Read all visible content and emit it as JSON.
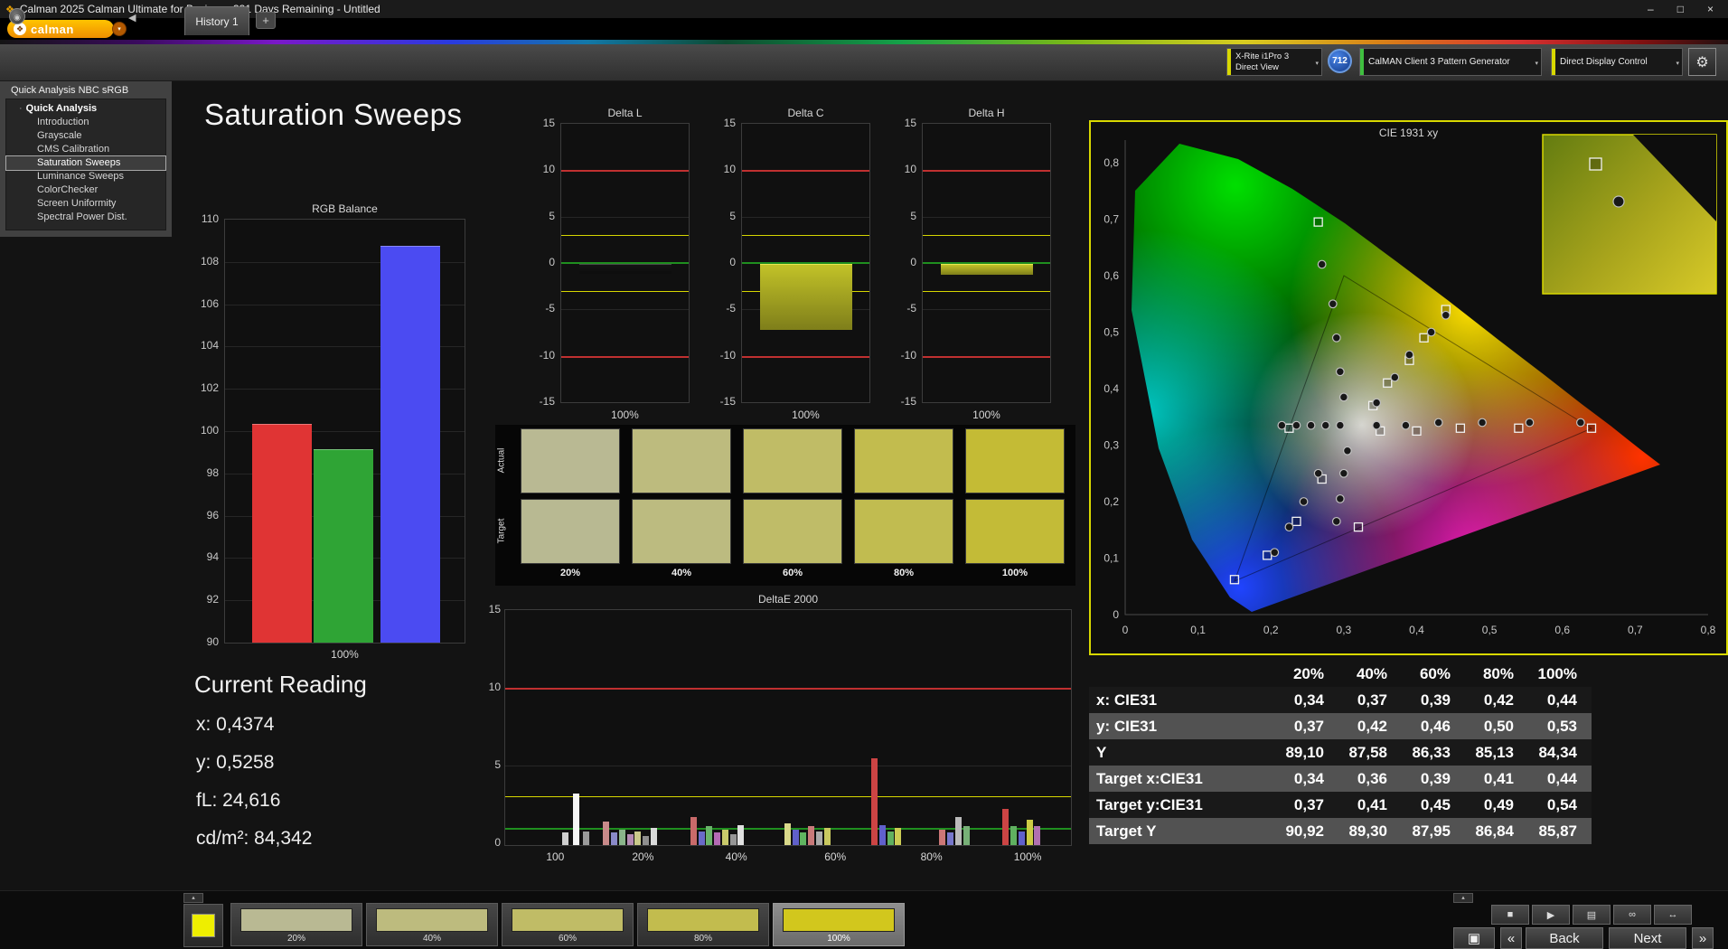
{
  "window": {
    "title": "Calman 2025 Calman Ultimate for Business 331 Days Remaining  - Untitled",
    "controls": {
      "minimize": "–",
      "maximize": "□",
      "close": "×"
    }
  },
  "logo": {
    "brand": "calman"
  },
  "icons": {
    "app": "❖",
    "brand": "❖",
    "brand_arrow": "▾",
    "panel": "◉",
    "collapse_left": "◀",
    "dropdown": "▾",
    "gear": "⚙",
    "collapse_up": "▴",
    "stop": "■",
    "play": "▶",
    "pattern": "▤",
    "loop": "∞",
    "swap": "↔",
    "window": "▣",
    "chev_prev": "«",
    "chev_next": "»"
  },
  "tabbar": {
    "history_tab": "History 1",
    "add_tab": "+"
  },
  "devices": {
    "meter": {
      "line1": "X-Rite i1Pro 3",
      "line2": "Direct View",
      "accent": "#d8d800"
    },
    "badge": "712",
    "source": {
      "label": "CalMAN Client 3 Pattern Generator",
      "accent": "#3fbf3f"
    },
    "display": {
      "label": "Direct Display Control",
      "accent": "#d8d800"
    }
  },
  "sidebar": {
    "header": "Quick Analysis NBC sRGB",
    "root": "Quick Analysis",
    "items": [
      {
        "label": "Introduction",
        "selected": false
      },
      {
        "label": "Grayscale",
        "selected": false
      },
      {
        "label": "CMS Calibration",
        "selected": false
      },
      {
        "label": "Saturation Sweeps",
        "selected": true
      },
      {
        "label": "Luminance Sweeps",
        "selected": false
      },
      {
        "label": "ColorChecker",
        "selected": false
      },
      {
        "label": "Screen Uniformity",
        "selected": false
      },
      {
        "label": "Spectral Power Dist.",
        "selected": false
      }
    ]
  },
  "page": {
    "title": "Saturation Sweeps"
  },
  "current_reading": {
    "title": "Current Reading",
    "x": "x: 0,4374",
    "y": "y: 0,5258",
    "fl": "fL: 24,616",
    "cd": "cd/m²: 84,342"
  },
  "patches": {
    "row_labels": [
      "Actual",
      "Target"
    ],
    "col_labels": [
      "20%",
      "40%",
      "60%",
      "80%",
      "100%"
    ],
    "actual_colors": [
      "#b9b993",
      "#bdbb7e",
      "#c0bc66",
      "#c2bc4e",
      "#c4bb35"
    ],
    "target_colors": [
      "#b8b992",
      "#bcbb80",
      "#bfbc68",
      "#c1bc50",
      "#c3bb37"
    ]
  },
  "chart_data": [
    {
      "name": "rgb_balance",
      "type": "bar",
      "title": "RGB Balance",
      "ylim": [
        90,
        110
      ],
      "yticks": [
        110,
        108,
        106,
        104,
        102,
        100,
        98,
        96,
        94,
        92,
        90
      ],
      "xlabel": "100%",
      "series": [
        {
          "name": "Red",
          "value": 100.3,
          "color": "#e03434"
        },
        {
          "name": "Green",
          "value": 99.1,
          "color": "#2fa435"
        },
        {
          "name": "Blue",
          "value": 108.7,
          "color": "#4b4bf2"
        }
      ]
    },
    {
      "name": "delta_l",
      "type": "bar",
      "title": "Delta L",
      "ylim": [
        -15,
        15
      ],
      "yticks": [
        15,
        10,
        5,
        0,
        -5,
        -10,
        -15
      ],
      "xlabel": "100%",
      "value": -1.0,
      "bar_color": "#141414",
      "bar_edge": "#4a4a4a",
      "ref": {
        "red": 10,
        "yellow": 3,
        "green": 0
      }
    },
    {
      "name": "delta_c",
      "type": "bar",
      "title": "Delta C",
      "ylim": [
        -15,
        15
      ],
      "yticks": [
        15,
        10,
        5,
        0,
        -5,
        -10,
        -15
      ],
      "xlabel": "100%",
      "value": -7.0,
      "bar_color": "#c2c228",
      "bar_edge": "#e8e850",
      "ref": {
        "red": 10,
        "yellow": 3,
        "green": 0
      }
    },
    {
      "name": "delta_h",
      "type": "bar",
      "title": "Delta H",
      "ylim": [
        -15,
        15
      ],
      "yticks": [
        15,
        10,
        5,
        0,
        -5,
        -10,
        -15
      ],
      "xlabel": "100%",
      "value": -1.1,
      "bar_color": "#c2c228",
      "bar_edge": "#e8e850",
      "ref": {
        "red": 10,
        "yellow": 3,
        "green": 0
      }
    },
    {
      "name": "deltae_2000",
      "type": "bar",
      "title": "DeltaE 2000",
      "ylim": [
        0,
        15
      ],
      "yticks": [
        15,
        10,
        5,
        0
      ],
      "ref": {
        "red": 10,
        "yellow": 3,
        "green": 1
      },
      "xlabels": [
        {
          "text": "100",
          "pos": 0.09
        },
        {
          "text": "20%",
          "pos": 0.245
        },
        {
          "text": "40%",
          "pos": 0.41
        },
        {
          "text": "60%",
          "pos": 0.585
        },
        {
          "text": "80%",
          "pos": 0.755
        },
        {
          "text": "100%",
          "pos": 0.925
        }
      ],
      "bars": [
        [
          0.105,
          0.8,
          "#cfcfcf"
        ],
        [
          0.125,
          3.3,
          "#f5f5f5"
        ],
        [
          0.142,
          0.9,
          "#9a9a9a"
        ],
        [
          0.178,
          1.5,
          "#c98a8a"
        ],
        [
          0.192,
          0.8,
          "#8a8ac9"
        ],
        [
          0.206,
          1.0,
          "#8ab48a"
        ],
        [
          0.22,
          0.7,
          "#b48ab4"
        ],
        [
          0.234,
          0.9,
          "#c9c98a"
        ],
        [
          0.248,
          0.6,
          "#8f8f8f"
        ],
        [
          0.262,
          1.1,
          "#d9d9d9"
        ],
        [
          0.332,
          1.8,
          "#c96a6a"
        ],
        [
          0.346,
          0.9,
          "#6a6ac9"
        ],
        [
          0.36,
          1.2,
          "#6ab46a"
        ],
        [
          0.374,
          0.8,
          "#b46ab4"
        ],
        [
          0.388,
          1.0,
          "#c9c96a"
        ],
        [
          0.402,
          0.7,
          "#969696"
        ],
        [
          0.416,
          1.3,
          "#e0e0e0"
        ],
        [
          0.498,
          1.4,
          "#d9d98a"
        ],
        [
          0.512,
          1.0,
          "#6060c9"
        ],
        [
          0.526,
          0.8,
          "#60b460"
        ],
        [
          0.54,
          1.2,
          "#c97a7a"
        ],
        [
          0.554,
          0.9,
          "#ababab"
        ],
        [
          0.568,
          1.1,
          "#c9c960"
        ],
        [
          0.652,
          5.6,
          "#cc4444"
        ],
        [
          0.666,
          1.3,
          "#6060cc"
        ],
        [
          0.68,
          0.9,
          "#60b060"
        ],
        [
          0.694,
          1.1,
          "#cccc55"
        ],
        [
          0.772,
          1.0,
          "#cc7777"
        ],
        [
          0.786,
          0.8,
          "#7777cc"
        ],
        [
          0.8,
          1.8,
          "#bbbbbb"
        ],
        [
          0.814,
          1.2,
          "#77b077"
        ],
        [
          0.884,
          2.3,
          "#cc4444"
        ],
        [
          0.898,
          1.2,
          "#60b060"
        ],
        [
          0.912,
          0.9,
          "#6060cc"
        ],
        [
          0.926,
          1.6,
          "#cccc44"
        ],
        [
          0.94,
          1.2,
          "#b070b0"
        ]
      ]
    },
    {
      "name": "cie_1931",
      "type": "scatter",
      "title": "CIE 1931 xy",
      "xlim": [
        0,
        0.8
      ],
      "ylim": [
        0,
        0.8
      ],
      "xtick_labels": [
        "0",
        "0,1",
        "0,2",
        "0,3",
        "0,4",
        "0,5",
        "0,6",
        "0,7",
        "0,8"
      ],
      "ytick_labels": [
        "0",
        "0,1",
        "0,2",
        "0,3",
        "0,4",
        "0,5",
        "0,6",
        "0,7",
        "0,8"
      ],
      "targets": [
        [
          0.34,
          0.37
        ],
        [
          0.36,
          0.41
        ],
        [
          0.39,
          0.45
        ],
        [
          0.41,
          0.49
        ],
        [
          0.44,
          0.54
        ],
        [
          0.35,
          0.325
        ],
        [
          0.4,
          0.325
        ],
        [
          0.46,
          0.33
        ],
        [
          0.54,
          0.33
        ],
        [
          0.64,
          0.33
        ],
        [
          0.265,
          0.695
        ],
        [
          0.27,
          0.24
        ],
        [
          0.235,
          0.165
        ],
        [
          0.195,
          0.105
        ],
        [
          0.15,
          0.062
        ],
        [
          0.225,
          0.33
        ],
        [
          0.32,
          0.155
        ]
      ],
      "measured": [
        [
          0.345,
          0.375
        ],
        [
          0.37,
          0.42
        ],
        [
          0.39,
          0.46
        ],
        [
          0.42,
          0.5
        ],
        [
          0.44,
          0.53
        ],
        [
          0.27,
          0.62
        ],
        [
          0.285,
          0.55
        ],
        [
          0.29,
          0.49
        ],
        [
          0.295,
          0.43
        ],
        [
          0.3,
          0.385
        ],
        [
          0.345,
          0.335
        ],
        [
          0.385,
          0.335
        ],
        [
          0.43,
          0.34
        ],
        [
          0.49,
          0.34
        ],
        [
          0.555,
          0.34
        ],
        [
          0.625,
          0.34
        ],
        [
          0.295,
          0.335
        ],
        [
          0.275,
          0.335
        ],
        [
          0.255,
          0.335
        ],
        [
          0.235,
          0.335
        ],
        [
          0.215,
          0.335
        ],
        [
          0.305,
          0.29
        ],
        [
          0.3,
          0.25
        ],
        [
          0.295,
          0.205
        ],
        [
          0.29,
          0.165
        ],
        [
          0.265,
          0.25
        ],
        [
          0.245,
          0.2
        ],
        [
          0.225,
          0.155
        ],
        [
          0.205,
          0.11
        ]
      ]
    }
  ],
  "table": {
    "headers": [
      "",
      "20%",
      "40%",
      "60%",
      "80%",
      "100%"
    ],
    "rows": [
      {
        "label": "x: CIE31",
        "values": [
          "0,34",
          "0,37",
          "0,39",
          "0,42",
          "0,44"
        ]
      },
      {
        "label": "y: CIE31",
        "values": [
          "0,37",
          "0,42",
          "0,46",
          "0,50",
          "0,53"
        ]
      },
      {
        "label": "Y",
        "values": [
          "89,10",
          "87,58",
          "86,33",
          "85,13",
          "84,34"
        ]
      },
      {
        "label": "Target x:CIE31",
        "values": [
          "0,34",
          "0,36",
          "0,39",
          "0,41",
          "0,44"
        ]
      },
      {
        "label": "Target y:CIE31",
        "values": [
          "0,37",
          "0,41",
          "0,45",
          "0,49",
          "0,54"
        ]
      },
      {
        "label": "Target Y",
        "values": [
          "90,92",
          "89,30",
          "87,95",
          "86,84",
          "85,87"
        ]
      }
    ]
  },
  "bottombar": {
    "swatch_color": "#eeee00",
    "patches": [
      {
        "label": "20%",
        "color": "#b9b993",
        "selected": false
      },
      {
        "label": "40%",
        "color": "#bdbb7e",
        "selected": false
      },
      {
        "label": "60%",
        "color": "#c0bc66",
        "selected": false
      },
      {
        "label": "80%",
        "color": "#c2bc4e",
        "selected": false
      },
      {
        "label": "100%",
        "color": "#d2c71d",
        "selected": true
      }
    ],
    "back_label": "Back",
    "next_label": "Next"
  }
}
